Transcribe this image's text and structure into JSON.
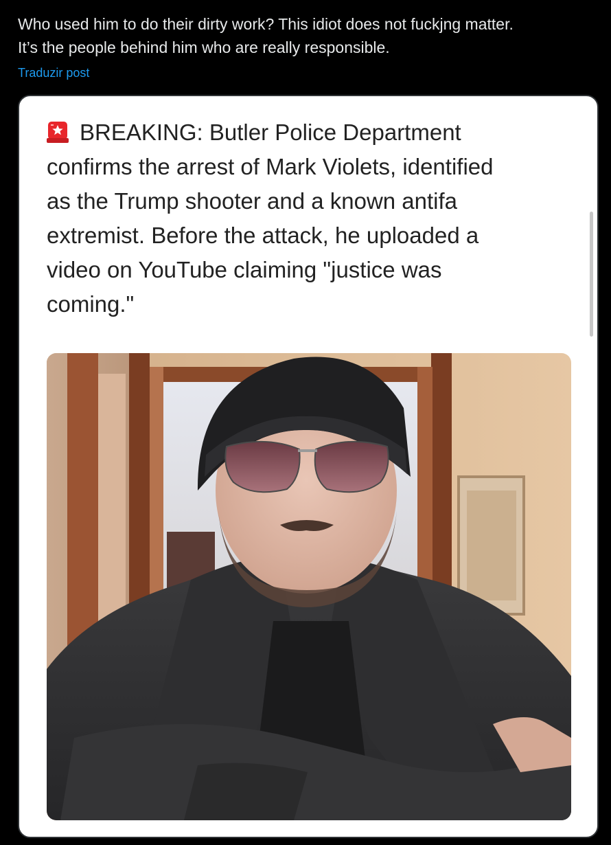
{
  "post": {
    "text_lines": [
      "Who used him to do their dirty work? This idiot does not fuckjng matter.",
      "It’s the people behind him who are really responsible."
    ],
    "translate_label": "Traduzir post"
  },
  "image": {
    "headline_lines": [
      "BREAKING: Butler Police Department",
      "confirms the arrest of Mark Violets, identified",
      "as the Trump shooter and a known antifa",
      "extremist. Before the attack, he uploaded a",
      "video on YouTube claiming \"justice was",
      "coming.\""
    ],
    "headline_icon": "rotating-light-icon",
    "photo_subject": "man in black beanie and sunglasses with arms crossed"
  },
  "colors": {
    "background": "#000000",
    "text": "#e7e9ea",
    "link": "#1d9bf0",
    "card_border": "#2f3336"
  }
}
